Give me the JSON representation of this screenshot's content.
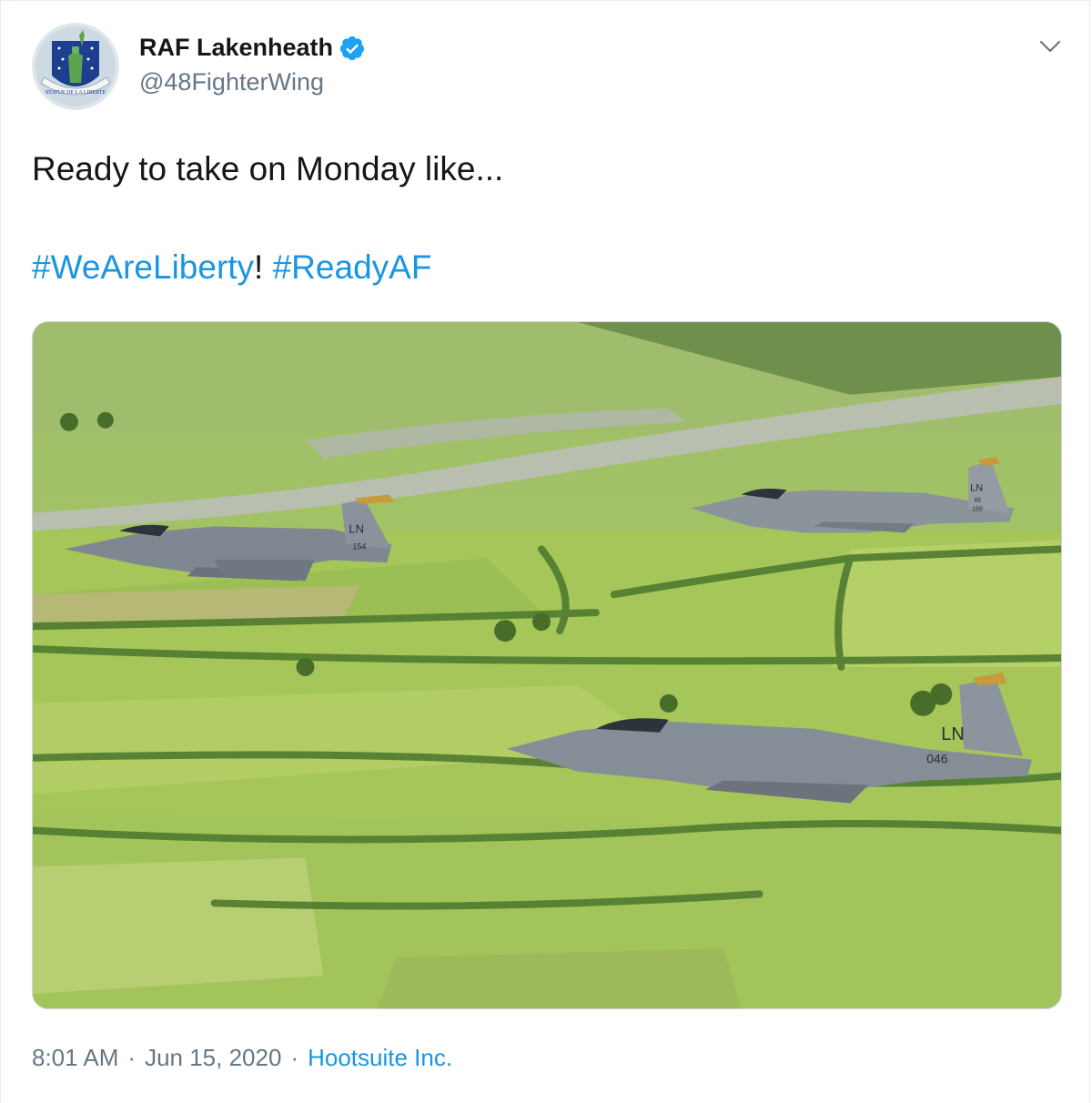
{
  "author": {
    "display_name": "RAF Lakenheath",
    "handle": "@48FighterWing",
    "verified": true,
    "avatar_text": "STATUE DE LA LIBERTE",
    "avatar_icon": "statue-of-liberty-badge"
  },
  "tweet": {
    "text_line1": "Ready to take on Monday like...",
    "hashtag1": "#WeAreLiberty",
    "separator": "!",
    "hashtag2": "#ReadyAF"
  },
  "media": {
    "description_icon": "photo-three-jets-over-farmland",
    "jets": [
      {
        "tail_code": "LN",
        "serial": "154"
      },
      {
        "tail_code": "LN",
        "wing": "48",
        "serial": "159"
      },
      {
        "tail_code": "LN",
        "serial": "046"
      }
    ]
  },
  "meta": {
    "time": "8:01 AM",
    "date": "Jun 15, 2020",
    "dot": "·",
    "source": "Hootsuite Inc."
  },
  "colors": {
    "link": "#1b95e0",
    "secondary_text": "#657786",
    "verified_badge": "#1da1f2"
  }
}
